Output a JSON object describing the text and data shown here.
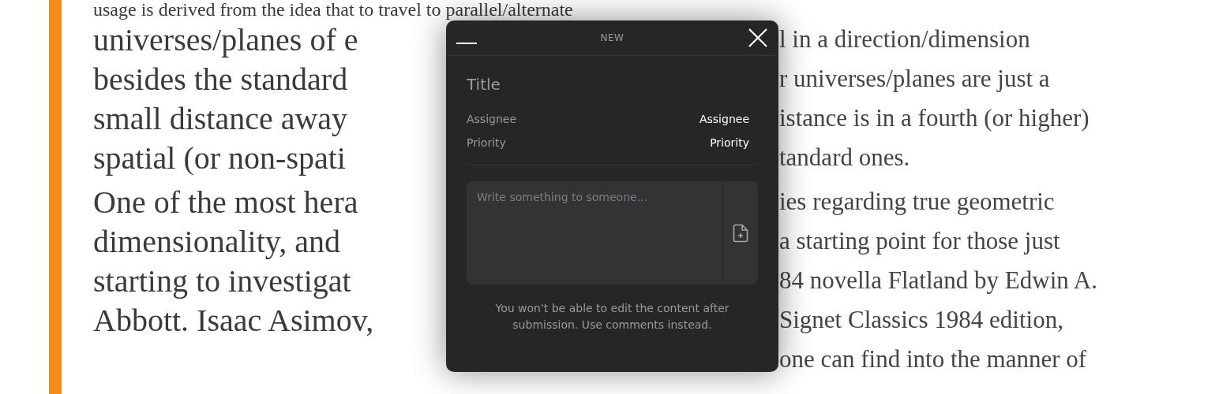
{
  "article": {
    "paragraphs": [
      {
        "lines": [
          {
            "left": "usage is derived from the idea that to travel to parallel/alternate"
          },
          {
            "left": "universes/planes of e",
            "right": "l in a direction/dimension"
          },
          {
            "left": "besides the standard",
            "right": "r universes/planes are just a"
          },
          {
            "left": "small distance away",
            "right": "istance is in a fourth (or higher)"
          },
          {
            "left": "spatial (or non-spati",
            "right": "tandard ones."
          }
        ]
      },
      {
        "lines": [
          {
            "left": "One of the most hera",
            "right": "ies regarding true geometric"
          },
          {
            "left": "dimensionality, and",
            "right": "a starting point for those just"
          },
          {
            "left": "starting to investigat",
            "right": "84 novella Flatland by Edwin A."
          },
          {
            "left": "Abbott. Isaac Asimov,",
            "right": "Signet Classics 1984 edition,"
          },
          {
            "right": "one can find into the manner of"
          }
        ]
      }
    ]
  },
  "dialog": {
    "title": "NEW",
    "title_field": {
      "placeholder": "Title"
    },
    "fields": [
      {
        "label": "Assignee",
        "value": "Assignee"
      },
      {
        "label": "Priority",
        "value": "Priority"
      }
    ],
    "message": {
      "placeholder": "Write something to someone..."
    },
    "note": "You won't be able to edit the content after submission. Use comments instead."
  }
}
